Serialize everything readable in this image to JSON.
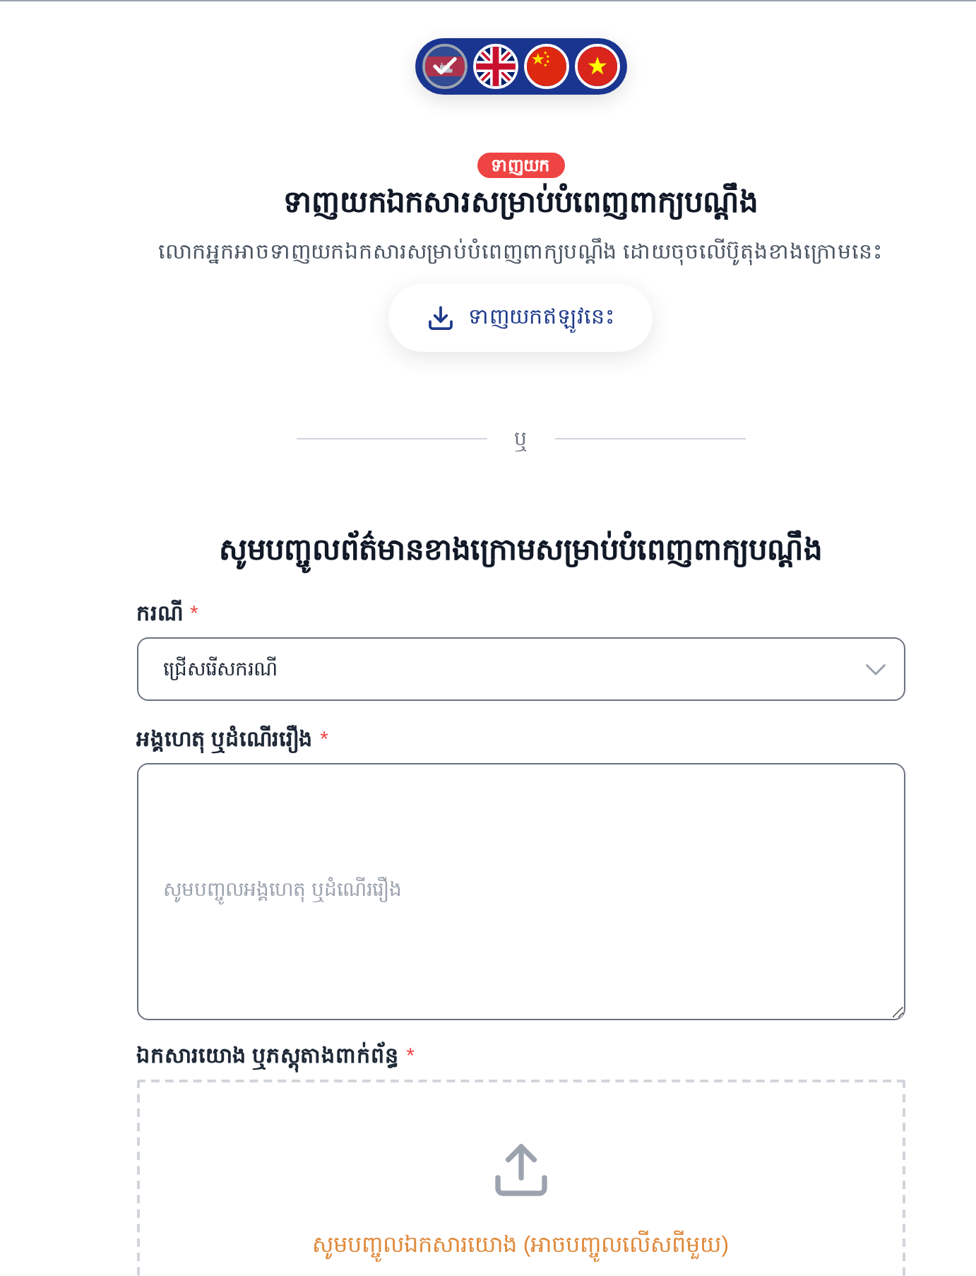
{
  "language_switcher": {
    "languages": [
      {
        "kind": "cambodia",
        "selected": true
      },
      {
        "kind": "uk",
        "selected": false
      },
      {
        "kind": "china",
        "selected": false
      },
      {
        "kind": "vietnam",
        "selected": false
      }
    ]
  },
  "download": {
    "badge": "ទាញយក",
    "title": "ទាញយកឯកសារសម្រាប់បំពេញពាក្យបណ្ដឹង",
    "description": "លោកអ្នកអាចទាញយកឯកសារសម្រាប់បំពេញពាក្យបណ្ដឹង ដោយចុចលើប៊ូតុងខាងក្រោមនេះ",
    "button": "ទាញយកឥឡូវនេះ"
  },
  "divider": "ឬ",
  "form": {
    "title": "សូមបញ្ចូលព័ត៌មានខាងក្រោមសម្រាប់បំពេញពាក្យបណ្ដឹង",
    "fields": [
      {
        "kind": "select",
        "label": "ករណី",
        "required_mark": "*",
        "placeholder": "ជ្រើសរើសករណី"
      },
      {
        "kind": "textarea",
        "label": "អង្គហេតុ ឬដំណើររឿង",
        "required_mark": "*",
        "placeholder": "សូមបញ្ចូលអង្គហេតុ ឬដំណើររឿង"
      },
      {
        "kind": "upload",
        "label": "ឯកសារយោង ឬភស្តុតាងពាក់ព័ន្ធ",
        "required_mark": "*",
        "prompt": "សូមបញ្ចូលឯកសារយោង (អាចបញ្ចូលលើសពីមួយ)"
      }
    ]
  }
}
